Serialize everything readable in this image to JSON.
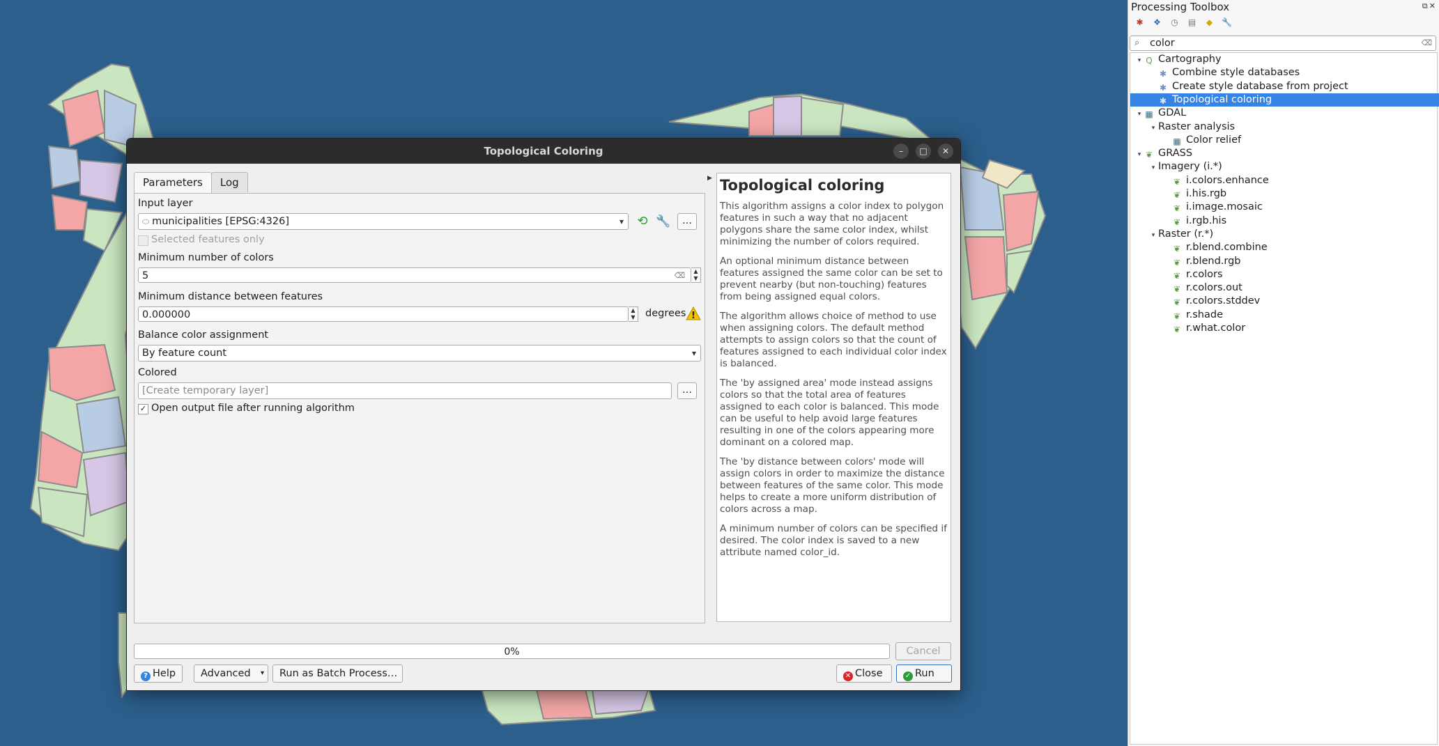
{
  "dialog": {
    "title": "Topological Coloring",
    "tabs": [
      "Parameters",
      "Log"
    ],
    "input_layer_label": "Input layer",
    "input_layer_value": "municipalities [EPSG:4326]",
    "selected_only_label": "Selected features only",
    "min_colors_label": "Minimum number of colors",
    "min_colors_value": "5",
    "min_distance_label": "Minimum distance between features",
    "min_distance_value": "0.000000",
    "min_distance_unit": "degrees",
    "balance_label": "Balance color assignment",
    "balance_value": "By feature count",
    "colored_label": "Colored",
    "colored_placeholder": "[Create temporary layer]",
    "open_output_label": "Open output file after running algorithm",
    "browse": "…",
    "progress_text": "0%",
    "cancel": "Cancel",
    "help": "Help",
    "advanced": "Advanced",
    "batch": "Run as Batch Process…",
    "close": "Close",
    "run": "Run"
  },
  "help_panel": {
    "heading": "Topological coloring",
    "paragraphs": [
      "This algorithm assigns a color index to polygon features in such a way that no adjacent polygons share the same color index, whilst minimizing the number of colors required.",
      "An optional minimum distance between features assigned the same color can be set to prevent nearby (but non-touching) features from being assigned equal colors.",
      "The algorithm allows choice of method to use when assigning colors. The default method attempts to assign colors so that the count of features assigned to each individual color index is balanced.",
      "The 'by assigned area' mode instead assigns colors so that the total area of features assigned to each color is balanced. This mode can be useful to help avoid large features resulting in one of the colors appearing more dominant on a colored map.",
      "The 'by distance between colors' mode will assign colors in order to maximize the distance between features of the same color. This mode helps to create a more uniform distribution of colors across a map.",
      "A minimum number of colors can be specified if desired. The color index is saved to a new attribute named color_id."
    ]
  },
  "toolbox": {
    "title": "Processing Toolbox",
    "search_value": "color",
    "tree": [
      {
        "label": "Cartography",
        "level": 0,
        "icon": "qgis-icon",
        "expander": "▾"
      },
      {
        "label": "Combine style databases",
        "level": 1,
        "icon": "gear-icon"
      },
      {
        "label": "Create style database from project",
        "level": 1,
        "icon": "gear-icon"
      },
      {
        "label": "Topological coloring",
        "level": 1,
        "icon": "gear-icon",
        "selected": true
      },
      {
        "label": "GDAL",
        "level": 0,
        "icon": "gdal-icon",
        "expander": "▾"
      },
      {
        "label": "Raster analysis",
        "level": 1,
        "icon": "",
        "expander": "▾"
      },
      {
        "label": "Color relief",
        "level": 2,
        "icon": "gdal-icon"
      },
      {
        "label": "GRASS",
        "level": 0,
        "icon": "grass-icon",
        "expander": "▾"
      },
      {
        "label": "Imagery (i.*)",
        "level": 1,
        "icon": "",
        "expander": "▾"
      },
      {
        "label": "i.colors.enhance",
        "level": 2,
        "icon": "grass-icon"
      },
      {
        "label": "i.his.rgb",
        "level": 2,
        "icon": "grass-icon"
      },
      {
        "label": "i.image.mosaic",
        "level": 2,
        "icon": "grass-icon"
      },
      {
        "label": "i.rgb.his",
        "level": 2,
        "icon": "grass-icon"
      },
      {
        "label": "Raster (r.*)",
        "level": 1,
        "icon": "",
        "expander": "▾"
      },
      {
        "label": "r.blend.combine",
        "level": 2,
        "icon": "grass-icon"
      },
      {
        "label": "r.blend.rgb",
        "level": 2,
        "icon": "grass-icon"
      },
      {
        "label": "r.colors",
        "level": 2,
        "icon": "grass-icon"
      },
      {
        "label": "r.colors.out",
        "level": 2,
        "icon": "grass-icon"
      },
      {
        "label": "r.colors.stddev",
        "level": 2,
        "icon": "grass-icon"
      },
      {
        "label": "r.shade",
        "level": 2,
        "icon": "grass-icon"
      },
      {
        "label": "r.what.color",
        "level": 2,
        "icon": "grass-icon"
      }
    ]
  },
  "colors": {
    "map_background": "#2c5f8c",
    "region_fill": [
      "#f4a6a6",
      "#c9e6c1",
      "#b8cce4",
      "#d7c7e6",
      "#f0e6c8"
    ],
    "selection": "#3584e4",
    "run_icon": "#2e9b3a",
    "close_icon": "#d8262b",
    "help_icon": "#3584e4",
    "warning": "#f2c200"
  }
}
